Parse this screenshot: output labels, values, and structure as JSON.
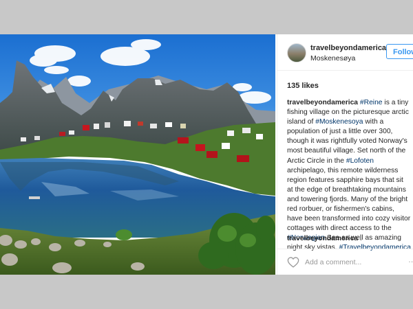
{
  "post": {
    "username": "travelbeyondamerica",
    "location": "Moskenesøya",
    "follow_label": "Follow",
    "likes": "135 likes",
    "caption": {
      "author": "travelbeyondamerica",
      "part1": "is a tiny fishing village on the picturesque arctic island of",
      "tag1": "#Reine",
      "tag2": "#Moskenesoya",
      "part2": "with a population of just a little over 300, though it was rightfully voted Norway's most beautiful village. Set north of the Arctic Circle in the",
      "tag3": "#Lofoten",
      "part3": "archipelago, this remote wilderness region features sapphire bays that sit at the edge of breathtaking mountains and towering fjords. Many of the bright red rorbuer, or fishermen's cabins, have been transformed into cozy visitor cottages with direct access to the",
      "tag4": "#Norwegian",
      "part4": "Sea as well as amazing night sky vistas.",
      "tag5": "#Travelbeyondamerica"
    },
    "comment": {
      "author": "travelbeyondamerica",
      "text": "."
    },
    "add_comment_placeholder": "Add a comment...",
    "more_label": "…"
  },
  "icons": {
    "heart": "heart-icon"
  },
  "colors": {
    "follow_blue": "#3897f0",
    "hashtag_blue": "#003569",
    "text": "#262626",
    "border": "#efefef"
  }
}
